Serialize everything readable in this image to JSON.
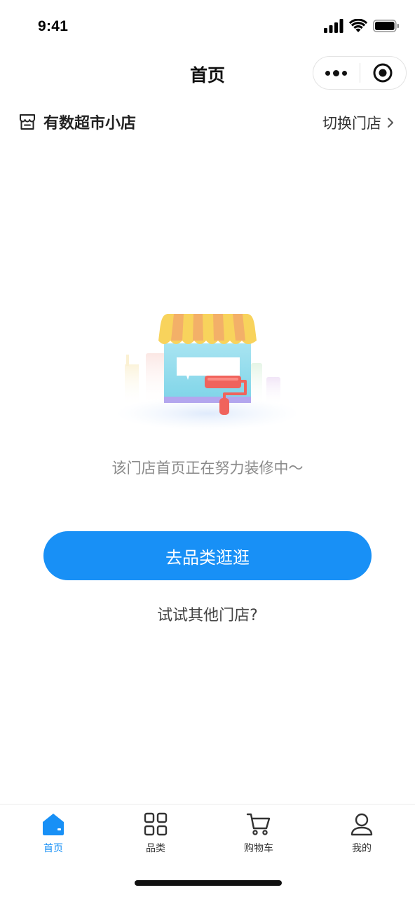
{
  "status_bar": {
    "time": "9:41"
  },
  "nav": {
    "title": "首页",
    "more_icon": "more-dots-icon",
    "close_icon": "target-circle-icon"
  },
  "store": {
    "icon": "store-icon",
    "name": "有数超市小店",
    "switch_label": "切换门店"
  },
  "empty_state": {
    "message": "该门店首页正在努力装修中～",
    "primary_button": "去品类逛逛",
    "secondary_link": "试试其他门店?"
  },
  "tabs": [
    {
      "label": "首页",
      "icon": "home-icon",
      "active": true
    },
    {
      "label": "品类",
      "icon": "grid-icon",
      "active": false
    },
    {
      "label": "购物车",
      "icon": "cart-icon",
      "active": false
    },
    {
      "label": "我的",
      "icon": "user-icon",
      "active": false
    }
  ],
  "colors": {
    "accent": "#1890f6",
    "text_muted": "#8a8a8a"
  }
}
